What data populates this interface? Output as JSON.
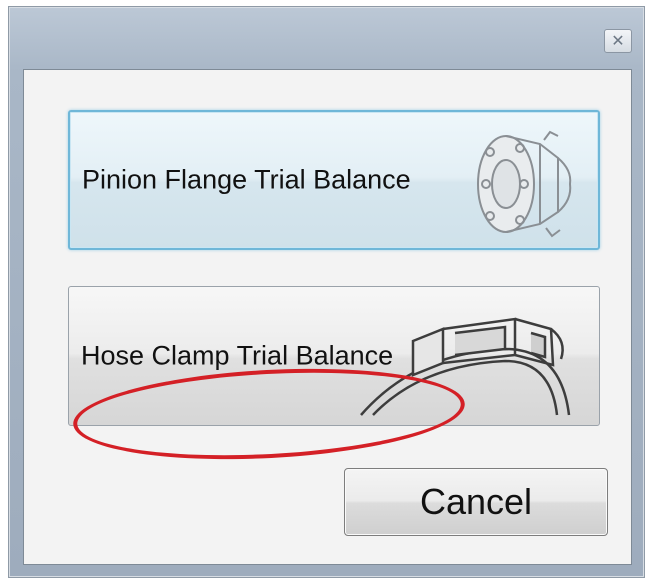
{
  "dialog": {
    "close_icon": "close-icon",
    "close_glyph": "✕"
  },
  "options": [
    {
      "label": "Pinion Flange Trial Balance",
      "icon": "pinion-flange-icon"
    },
    {
      "label": "Hose Clamp Trial Balance",
      "icon": "hose-clamp-icon"
    }
  ],
  "cancel_label": "Cancel",
  "annotation": {
    "type": "red-ellipse-highlight",
    "target": "Hose Clamp Trial Balance",
    "color": "#d42026"
  },
  "colors": {
    "selected_border": "#6fb7d8",
    "annotation": "#d42026"
  }
}
